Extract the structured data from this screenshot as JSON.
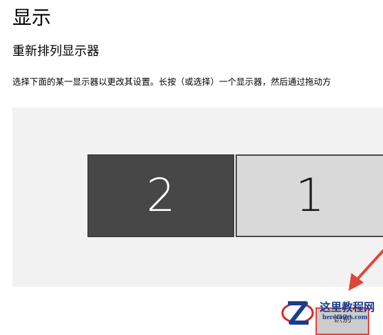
{
  "page": {
    "title": "显示",
    "section_title": "重新排列显示器",
    "description": "选择下面的某一显示器以更改其设置。长按（或选择）一个显示器，然后通过拖动方"
  },
  "displays": [
    {
      "number": "2"
    },
    {
      "number": "1"
    }
  ],
  "identify_button": {
    "label": "识别"
  },
  "watermark": {
    "name": "这里教程网",
    "url": "herecours.com"
  },
  "colors": {
    "monitor_dark": "#474747",
    "monitor_light": "#d9d9d9",
    "arrow": "#e0453a",
    "watermark_blue": "#1a3c8c",
    "watermark_red": "#d12b2b"
  }
}
